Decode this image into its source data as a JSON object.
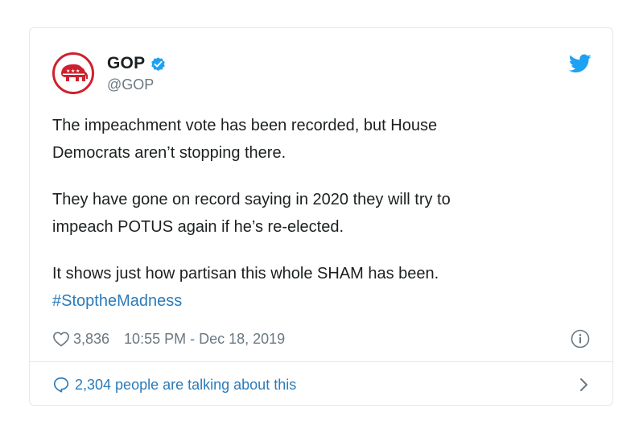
{
  "tweet": {
    "account": {
      "name": "GOP",
      "handle": "@GOP",
      "verified": true,
      "avatar_icon": "gop-elephant-logo"
    },
    "paragraphs": [
      [
        "The impeachment vote has been recorded, but House",
        "Democrats aren’t stopping there."
      ],
      [
        "They have gone on record saying in 2020 they will try to",
        "impeach POTUS again if he’s re-elected."
      ],
      [
        "It shows just how partisan this whole SHAM has been."
      ]
    ],
    "hashtag": "#StoptheMadness",
    "likes": "3,836",
    "timestamp": "10:55 PM - Dec 18, 2019",
    "talking": "2,304 people are talking about this"
  },
  "colors": {
    "brand_blue": "#1da1f2",
    "link_blue": "#2b7bb9",
    "gop_red": "#d0202e",
    "muted_gray": "#697882"
  }
}
